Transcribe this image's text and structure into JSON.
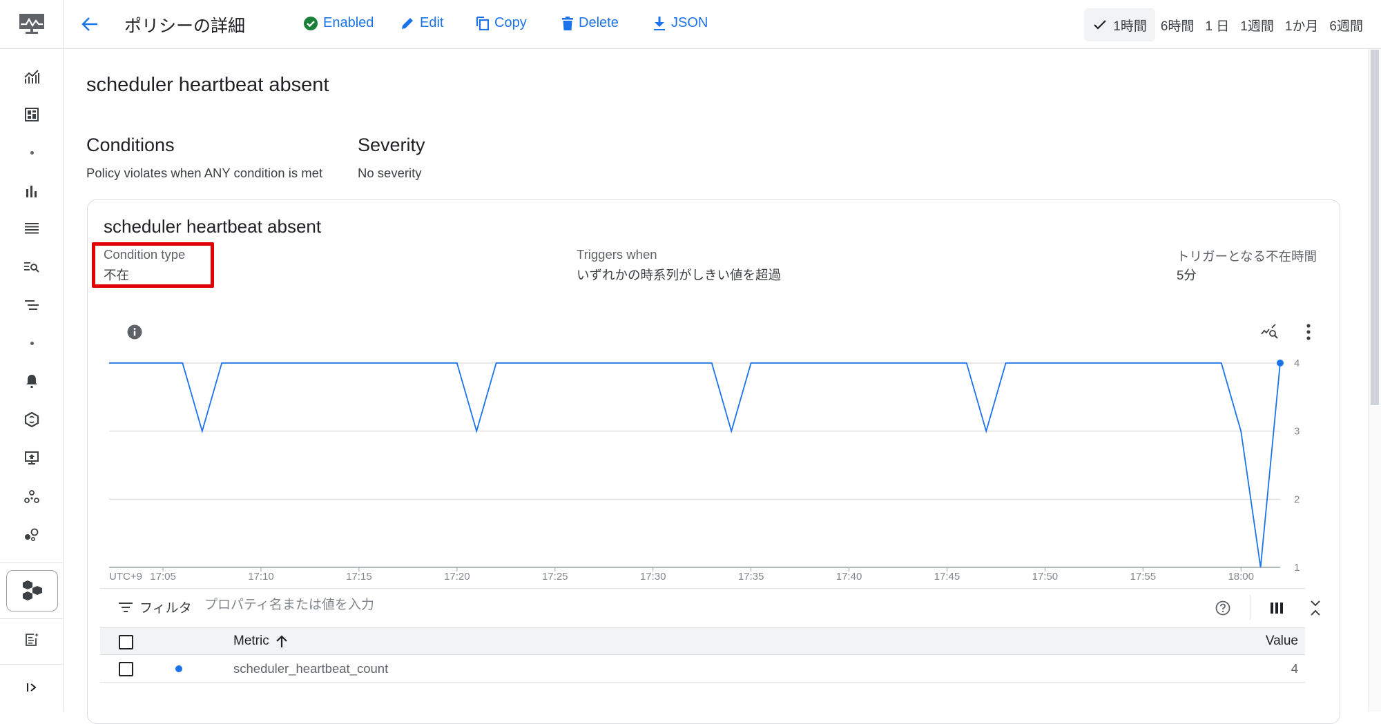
{
  "header": {
    "title": "ポリシーの詳細",
    "actions": {
      "enabled": "Enabled",
      "edit": "Edit",
      "copy": "Copy",
      "delete": "Delete",
      "json": "JSON"
    },
    "time_ranges": [
      {
        "label": "1時間",
        "selected": true
      },
      {
        "label": "6時間",
        "selected": false
      },
      {
        "label": "1 日",
        "selected": false
      },
      {
        "label": "1週間",
        "selected": false
      },
      {
        "label": "1か月",
        "selected": false
      },
      {
        "label": "6週間",
        "selected": false
      }
    ]
  },
  "sidebar": {
    "icons": [
      "monitoring-logo-icon",
      "metrics-explorer-icon",
      "dashboards-icon",
      "dot",
      "bar-chart-icon",
      "logs-icon",
      "logs-search-icon",
      "filter-list-icon",
      "dot",
      "alerting-bell-icon",
      "sync-icon",
      "monitor-icon",
      "services-icon",
      "groups-icon",
      "integrations-hexagon-icon",
      "notes-sparkle-icon",
      "expand-sidebar-icon"
    ]
  },
  "policy": {
    "name": "scheduler heartbeat absent",
    "conditions_heading": "Conditions",
    "conditions_text": "Policy violates when ANY condition is met",
    "severity_heading": "Severity",
    "severity_text": "No severity"
  },
  "condition": {
    "title": "scheduler heartbeat absent",
    "type_label": "Condition type",
    "type_value": "不在",
    "triggers_label": "Triggers when",
    "triggers_value": "いずれかの時系列がしきい値を超過",
    "duration_label": "トリガーとなる不在時間",
    "duration_value": "5分"
  },
  "chart_data": {
    "type": "line",
    "title": "",
    "xlabel": "",
    "ylabel": "",
    "timezone_label": "UTC+9",
    "x_ticks": [
      "17:05",
      "17:10",
      "17:15",
      "17:20",
      "17:25",
      "17:30",
      "17:35",
      "17:40",
      "17:45",
      "17:50",
      "17:55",
      "18:00"
    ],
    "y_ticks": [
      1,
      2,
      3,
      4
    ],
    "xlim": [
      "17:02",
      "18:02"
    ],
    "ylim": [
      1,
      4
    ],
    "grid": true,
    "series": [
      {
        "name": "scheduler_heartbeat_count",
        "color": "#1a73e8",
        "x": [
          "17:02",
          "17:06",
          "17:07",
          "17:08",
          "17:20",
          "17:21",
          "17:22",
          "17:33",
          "17:34",
          "17:35",
          "17:46",
          "17:47",
          "17:48",
          "17:59",
          "18:00",
          "18:01",
          "18:02"
        ],
        "values": [
          4,
          4,
          3,
          4,
          4,
          3,
          4,
          4,
          3,
          4,
          4,
          3,
          4,
          4,
          3,
          1,
          4
        ]
      }
    ]
  },
  "filter": {
    "label": "フィルタ",
    "placeholder": "プロパティ名または値を入力"
  },
  "table": {
    "columns": {
      "metric": "Metric",
      "value": "Value"
    },
    "rows": [
      {
        "metric": "scheduler_heartbeat_count",
        "value": "4",
        "color": "#1a73e8"
      }
    ]
  }
}
